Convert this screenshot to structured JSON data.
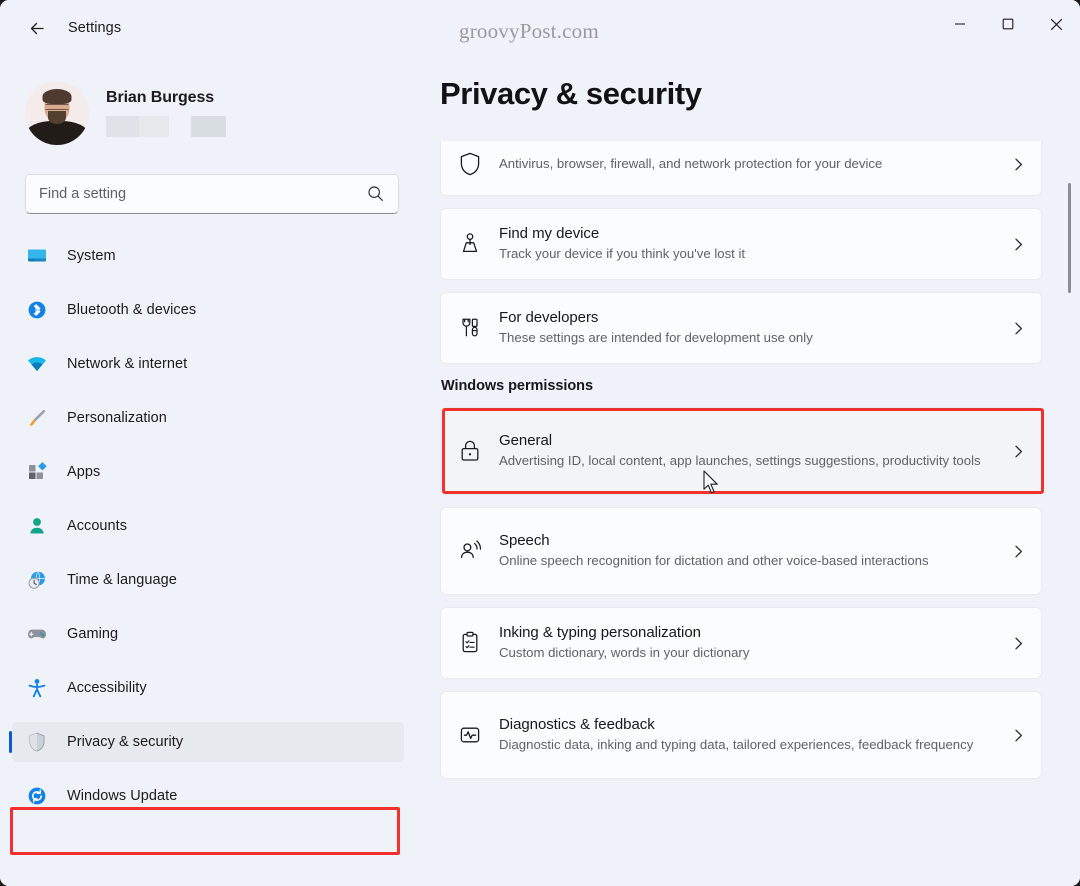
{
  "window": {
    "app_title": "Settings",
    "watermark": "groovyPost.com",
    "controls": {
      "minimize": "Minimize",
      "maximize": "Maximize",
      "close": "Close"
    },
    "back_label": "Back"
  },
  "sidebar": {
    "profile": {
      "name": "Brian Burgess",
      "redacted_line_1": "",
      "redacted_line_2": ""
    },
    "search": {
      "placeholder": "Find a setting",
      "value": ""
    },
    "items": [
      {
        "label": "System",
        "icon": "monitor-icon",
        "selected": false
      },
      {
        "label": "Bluetooth & devices",
        "icon": "bluetooth-icon",
        "selected": false
      },
      {
        "label": "Network & internet",
        "icon": "wifi-icon",
        "selected": false
      },
      {
        "label": "Personalization",
        "icon": "brush-icon",
        "selected": false
      },
      {
        "label": "Apps",
        "icon": "apps-icon",
        "selected": false
      },
      {
        "label": "Accounts",
        "icon": "person-icon",
        "selected": false
      },
      {
        "label": "Time & language",
        "icon": "clock-globe-icon",
        "selected": false
      },
      {
        "label": "Gaming",
        "icon": "gamepad-icon",
        "selected": false
      },
      {
        "label": "Accessibility",
        "icon": "accessibility-icon",
        "selected": false
      },
      {
        "label": "Privacy & security",
        "icon": "shield-icon",
        "selected": true
      },
      {
        "label": "Windows Update",
        "icon": "update-icon",
        "selected": false
      }
    ]
  },
  "main": {
    "page_title": "Privacy & security",
    "clipped_card": {
      "title": "",
      "sub": "Antivirus, browser, firewall, and network protection for your device",
      "icon": "shield-check-icon"
    },
    "cards_top": [
      {
        "title": "Find my device",
        "sub": "Track your device if you think you've lost it",
        "icon": "find-device-icon",
        "highlighted": false
      },
      {
        "title": "For developers",
        "sub": "These settings are intended for development use only",
        "icon": "tools-icon",
        "highlighted": false
      }
    ],
    "section_title": "Windows permissions",
    "cards_permissions": [
      {
        "title": "General",
        "sub": "Advertising ID, local content, app launches, settings suggestions, productivity tools",
        "icon": "lock-icon",
        "highlighted": true
      },
      {
        "title": "Speech",
        "sub": "Online speech recognition for dictation and other voice-based interactions",
        "icon": "speech-icon",
        "highlighted": false
      },
      {
        "title": "Inking & typing personalization",
        "sub": "Custom dictionary, words in your dictionary",
        "icon": "clipboard-icon",
        "highlighted": false
      },
      {
        "title": "Diagnostics & feedback",
        "sub": "Diagnostic data, inking and typing data, tailored experiences, feedback frequency",
        "icon": "pulse-icon",
        "highlighted": false
      }
    ]
  },
  "colors": {
    "window_bg": "#eff3f9",
    "card_bg": "#fbfcfd",
    "accent_blue": "#0a5cd6",
    "callout_red": "#f2312f",
    "text_primary": "#16181c",
    "text_secondary": "#5e6167"
  }
}
